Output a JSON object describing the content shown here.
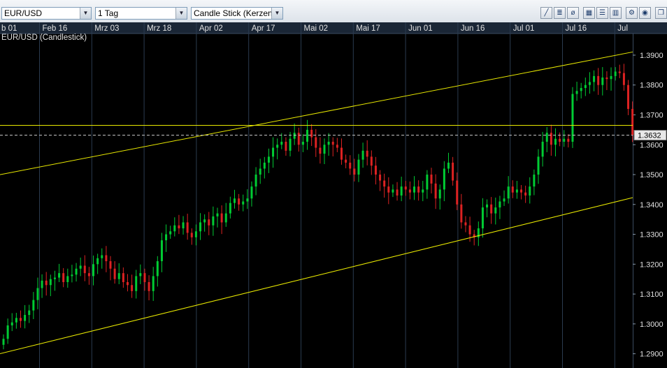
{
  "toolbar": {
    "symbol": "EUR/USD",
    "interval": "1 Tag",
    "chart_type": "Candle Stick (Kerzen",
    "dropdown_icon": "chevron-down-icon",
    "tools": [
      "line-tool-icon",
      "channel-tool-icon",
      "fib-tool-icon",
      "grid-icon",
      "rows-icon",
      "columns-icon",
      "gear-icon",
      "settings-icon",
      "detach-icon"
    ]
  },
  "colors": {
    "background": "#000000",
    "up_candle": "#00cc33",
    "down_candle": "#dd2222",
    "channel_line": "#e8e800",
    "price_line": "#cccccc",
    "grid": "#2b3b4f"
  },
  "chart_data": {
    "type": "candlestick",
    "title": "EUR/USD (Candlestick)",
    "x_ticks": [
      "b 01",
      "Feb 16",
      "Mrz 03",
      "Mrz 18",
      "Apr 02",
      "Apr 17",
      "Mai 02",
      "Mai 17",
      "Jun 01",
      "Jun 16",
      "Jul 01",
      "Jul 16",
      "Jul"
    ],
    "y_ticks": [
      1.39,
      1.38,
      1.37,
      1.36,
      1.35,
      1.34,
      1.33,
      1.32,
      1.31,
      1.3,
      1.29
    ],
    "ylim": [
      1.285,
      1.3935
    ],
    "last_price": "1.3632",
    "horizontal_line": 1.3665,
    "trend_lines": [
      {
        "name": "upper",
        "from": [
          0,
          1.3502
        ],
        "to": [
          140,
          1.3891
        ]
      },
      {
        "name": "lower",
        "from": [
          0,
          1.2903
        ],
        "to": [
          140,
          1.3398
        ]
      }
    ],
    "candles_close": [
      1.295,
      1.2995,
      1.3005,
      1.302,
      1.301,
      1.303,
      1.3045,
      1.308,
      1.312,
      1.3145,
      1.313,
      1.315,
      1.3155,
      1.317,
      1.314,
      1.316,
      1.3165,
      1.3185,
      1.3195,
      1.317,
      1.316,
      1.32,
      1.322,
      1.323,
      1.321,
      1.3185,
      1.315,
      1.317,
      1.314,
      1.313,
      1.311,
      1.316,
      1.317,
      1.314,
      1.311,
      1.316,
      1.321,
      1.328,
      1.33,
      1.331,
      1.333,
      1.332,
      1.334,
      1.3305,
      1.329,
      1.331,
      1.334,
      1.335,
      1.333,
      1.336,
      1.337,
      1.334,
      1.337,
      1.3405,
      1.342,
      1.34,
      1.341,
      1.342,
      1.346,
      1.35,
      1.352,
      1.354,
      1.356,
      1.359,
      1.36,
      1.361,
      1.358,
      1.362,
      1.364,
      1.36,
      1.361,
      1.365,
      1.3625,
      1.359,
      1.357,
      1.36,
      1.361,
      1.36,
      1.359,
      1.355,
      1.354,
      1.352,
      1.35,
      1.355,
      1.358,
      1.356,
      1.353,
      1.35,
      1.348,
      1.346,
      1.344,
      1.345,
      1.343,
      1.346,
      1.345,
      1.344,
      1.346,
      1.344,
      1.345,
      1.35,
      1.347,
      1.342,
      1.345,
      1.352,
      1.354,
      1.348,
      1.34,
      1.334,
      1.333,
      1.33,
      1.329,
      1.332,
      1.339,
      1.34,
      1.337,
      1.339,
      1.341,
      1.342,
      1.346,
      1.344,
      1.345,
      1.344,
      1.343,
      1.346,
      1.35,
      1.356,
      1.361,
      1.364,
      1.36,
      1.362,
      1.361,
      1.362,
      1.361,
      1.377,
      1.378,
      1.379,
      1.38,
      1.381,
      1.383,
      1.38,
      1.3825,
      1.382,
      1.383,
      1.3845,
      1.384,
      1.38,
      1.372,
      1.3632
    ]
  }
}
